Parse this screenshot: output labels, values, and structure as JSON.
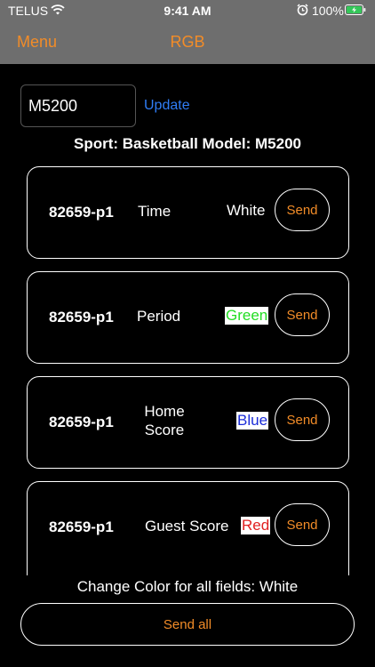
{
  "status_bar": {
    "carrier": "TELUS",
    "time": "9:41 AM",
    "battery": "100%",
    "battery_color": "#34c759"
  },
  "nav": {
    "menu_label": "Menu",
    "title": "RGB",
    "accent_color": "#f28c28"
  },
  "model_input": {
    "value": "M5200"
  },
  "update_label": "Update",
  "info": {
    "text": "Sport:  Basketball  Model:  M5200"
  },
  "cards": [
    {
      "id": "82659-p1",
      "field": "Time",
      "color_label": "White",
      "send_label": "Send"
    },
    {
      "id": "82659-p1",
      "field": "Period",
      "color_label": "Green",
      "send_label": "Send"
    },
    {
      "id": "82659-p1",
      "field": "Home\nScore",
      "color_label": "Blue",
      "send_label": "Send"
    },
    {
      "id": "82659-p1",
      "field": "Guest Score",
      "color_label": "Red",
      "send_label": "Send"
    }
  ],
  "change_all": {
    "text": "Change Color for all fields:  White"
  },
  "send_all_label": "Send all"
}
